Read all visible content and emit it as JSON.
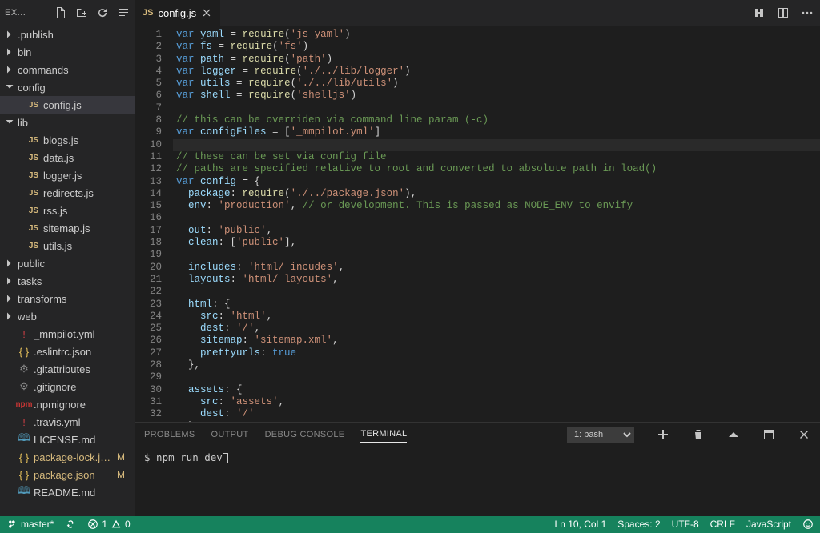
{
  "sidebar": {
    "title": "EX...",
    "items": [
      {
        "name": ".publish",
        "kind": "folder",
        "depth": 0,
        "expanded": false
      },
      {
        "name": "bin",
        "kind": "folder",
        "depth": 0,
        "expanded": false
      },
      {
        "name": "commands",
        "kind": "folder",
        "depth": 0,
        "expanded": false
      },
      {
        "name": "config",
        "kind": "folder",
        "depth": 0,
        "expanded": true
      },
      {
        "name": "config.js",
        "kind": "js",
        "depth": 1,
        "selected": true
      },
      {
        "name": "lib",
        "kind": "folder",
        "depth": 0,
        "expanded": true
      },
      {
        "name": "blogs.js",
        "kind": "js",
        "depth": 1
      },
      {
        "name": "data.js",
        "kind": "js",
        "depth": 1
      },
      {
        "name": "logger.js",
        "kind": "js",
        "depth": 1
      },
      {
        "name": "redirects.js",
        "kind": "js",
        "depth": 1
      },
      {
        "name": "rss.js",
        "kind": "js",
        "depth": 1
      },
      {
        "name": "sitemap.js",
        "kind": "js",
        "depth": 1
      },
      {
        "name": "utils.js",
        "kind": "js",
        "depth": 1
      },
      {
        "name": "public",
        "kind": "folder",
        "depth": 0,
        "expanded": false
      },
      {
        "name": "tasks",
        "kind": "folder",
        "depth": 0,
        "expanded": false
      },
      {
        "name": "transforms",
        "kind": "folder",
        "depth": 0,
        "expanded": false
      },
      {
        "name": "web",
        "kind": "folder",
        "depth": 0,
        "expanded": false
      },
      {
        "name": "_mmpilot.yml",
        "kind": "yml",
        "depth": 0
      },
      {
        "name": ".eslintrc.json",
        "kind": "json",
        "depth": 0
      },
      {
        "name": ".gitattributes",
        "kind": "generic",
        "depth": 0
      },
      {
        "name": ".gitignore",
        "kind": "generic",
        "depth": 0
      },
      {
        "name": ".npmignore",
        "kind": "npm",
        "depth": 0
      },
      {
        "name": ".travis.yml",
        "kind": "yml",
        "depth": 0
      },
      {
        "name": "LICENSE.md",
        "kind": "md",
        "depth": 0
      },
      {
        "name": "package-lock.json",
        "kind": "json",
        "depth": 0,
        "modified": true,
        "badge": "M"
      },
      {
        "name": "package.json",
        "kind": "json",
        "depth": 0,
        "modified": true,
        "badge": "M"
      },
      {
        "name": "README.md",
        "kind": "md",
        "depth": 0
      }
    ]
  },
  "tabs": {
    "open": [
      {
        "label": "config.js",
        "lang": "js"
      }
    ]
  },
  "editor": {
    "lines": [
      [
        [
          "kw",
          "var"
        ],
        [
          "",
          " "
        ],
        [
          "ident",
          "yaml"
        ],
        [
          "",
          " = "
        ],
        [
          "fn",
          "require"
        ],
        [
          "",
          "("
        ],
        [
          "str",
          "'js-yaml'"
        ],
        [
          "",
          ")"
        ]
      ],
      [
        [
          "kw",
          "var"
        ],
        [
          "",
          " "
        ],
        [
          "ident",
          "fs"
        ],
        [
          "",
          " = "
        ],
        [
          "fn",
          "require"
        ],
        [
          "",
          "("
        ],
        [
          "str",
          "'fs'"
        ],
        [
          "",
          ")"
        ]
      ],
      [
        [
          "kw",
          "var"
        ],
        [
          "",
          " "
        ],
        [
          "ident",
          "path"
        ],
        [
          "",
          " = "
        ],
        [
          "fn",
          "require"
        ],
        [
          "",
          "("
        ],
        [
          "str",
          "'path'"
        ],
        [
          "",
          ")"
        ]
      ],
      [
        [
          "kw",
          "var"
        ],
        [
          "",
          " "
        ],
        [
          "ident",
          "logger"
        ],
        [
          "",
          " = "
        ],
        [
          "fn",
          "require"
        ],
        [
          "",
          "("
        ],
        [
          "str",
          "'./../lib/logger'"
        ],
        [
          "",
          ")"
        ]
      ],
      [
        [
          "kw",
          "var"
        ],
        [
          "",
          " "
        ],
        [
          "ident",
          "utils"
        ],
        [
          "",
          " = "
        ],
        [
          "fn",
          "require"
        ],
        [
          "",
          "("
        ],
        [
          "str",
          "'./../lib/utils'"
        ],
        [
          "",
          ")"
        ]
      ],
      [
        [
          "kw",
          "var"
        ],
        [
          "",
          " "
        ],
        [
          "ident",
          "shell"
        ],
        [
          "",
          " = "
        ],
        [
          "fn",
          "require"
        ],
        [
          "",
          "("
        ],
        [
          "str",
          "'shelljs'"
        ],
        [
          "",
          ")"
        ]
      ],
      [],
      [
        [
          "com",
          "// this can be overriden via command line param (-c)"
        ]
      ],
      [
        [
          "kw",
          "var"
        ],
        [
          "",
          " "
        ],
        [
          "ident",
          "configFiles"
        ],
        [
          "",
          " = ["
        ],
        [
          "str",
          "'_mmpilot.yml'"
        ],
        [
          "",
          "]"
        ]
      ],
      [],
      [
        [
          "com",
          "// these can be set via config file"
        ]
      ],
      [
        [
          "com",
          "// paths are specified relative to root and converted to absolute path in load()"
        ]
      ],
      [
        [
          "kw",
          "var"
        ],
        [
          "",
          " "
        ],
        [
          "ident",
          "config"
        ],
        [
          "",
          " = {"
        ]
      ],
      [
        [
          "",
          "  "
        ],
        [
          "prop",
          "package"
        ],
        [
          "",
          ": "
        ],
        [
          "fn",
          "require"
        ],
        [
          "",
          "("
        ],
        [
          "str",
          "'./../package.json'"
        ],
        [
          "",
          "),"
        ]
      ],
      [
        [
          "",
          "  "
        ],
        [
          "prop",
          "env"
        ],
        [
          "",
          ": "
        ],
        [
          "str",
          "'production'"
        ],
        [
          "",
          ", "
        ],
        [
          "com",
          "// or development. This is passed as NODE_ENV to envify"
        ]
      ],
      [],
      [
        [
          "",
          "  "
        ],
        [
          "prop",
          "out"
        ],
        [
          "",
          ": "
        ],
        [
          "str",
          "'public'"
        ],
        [
          "",
          ","
        ]
      ],
      [
        [
          "",
          "  "
        ],
        [
          "prop",
          "clean"
        ],
        [
          "",
          ": ["
        ],
        [
          "str",
          "'public'"
        ],
        [
          "",
          "],"
        ]
      ],
      [],
      [
        [
          "",
          "  "
        ],
        [
          "prop",
          "includes"
        ],
        [
          "",
          ": "
        ],
        [
          "str",
          "'html/_incudes'"
        ],
        [
          "",
          ","
        ]
      ],
      [
        [
          "",
          "  "
        ],
        [
          "prop",
          "layouts"
        ],
        [
          "",
          ": "
        ],
        [
          "str",
          "'html/_layouts'"
        ],
        [
          "",
          ","
        ]
      ],
      [],
      [
        [
          "",
          "  "
        ],
        [
          "prop",
          "html"
        ],
        [
          "",
          ": {"
        ]
      ],
      [
        [
          "",
          "    "
        ],
        [
          "prop",
          "src"
        ],
        [
          "",
          ": "
        ],
        [
          "str",
          "'html'"
        ],
        [
          "",
          ","
        ]
      ],
      [
        [
          "",
          "    "
        ],
        [
          "prop",
          "dest"
        ],
        [
          "",
          ": "
        ],
        [
          "str",
          "'/'"
        ],
        [
          "",
          ","
        ]
      ],
      [
        [
          "",
          "    "
        ],
        [
          "prop",
          "sitemap"
        ],
        [
          "",
          ": "
        ],
        [
          "str",
          "'sitemap.xml'"
        ],
        [
          "",
          ","
        ]
      ],
      [
        [
          "",
          "    "
        ],
        [
          "prop",
          "prettyurls"
        ],
        [
          "",
          ": "
        ],
        [
          "bool",
          "true"
        ]
      ],
      [
        [
          "",
          "  },"
        ]
      ],
      [],
      [
        [
          "",
          "  "
        ],
        [
          "prop",
          "assets"
        ],
        [
          "",
          ": {"
        ]
      ],
      [
        [
          "",
          "    "
        ],
        [
          "prop",
          "src"
        ],
        [
          "",
          ": "
        ],
        [
          "str",
          "'assets'"
        ],
        [
          "",
          ","
        ]
      ],
      [
        [
          "",
          "    "
        ],
        [
          "prop",
          "dest"
        ],
        [
          "",
          ": "
        ],
        [
          "str",
          "'/'"
        ]
      ],
      [
        [
          "",
          "  },"
        ]
      ],
      []
    ],
    "first_line_number": 1,
    "highlighted_line": 10
  },
  "panel": {
    "tabs": [
      "PROBLEMS",
      "OUTPUT",
      "DEBUG CONSOLE",
      "TERMINAL"
    ],
    "active": "TERMINAL",
    "terminal_selector_label": "1: bash",
    "terminal_line": "$ npm run dev"
  },
  "statusbar": {
    "branch": "master*",
    "errors": "1",
    "warnings": "0",
    "ln_col": "Ln 10, Col 1",
    "spaces": "Spaces: 2",
    "encoding": "UTF-8",
    "eol": "CRLF",
    "lang": "JavaScript"
  }
}
